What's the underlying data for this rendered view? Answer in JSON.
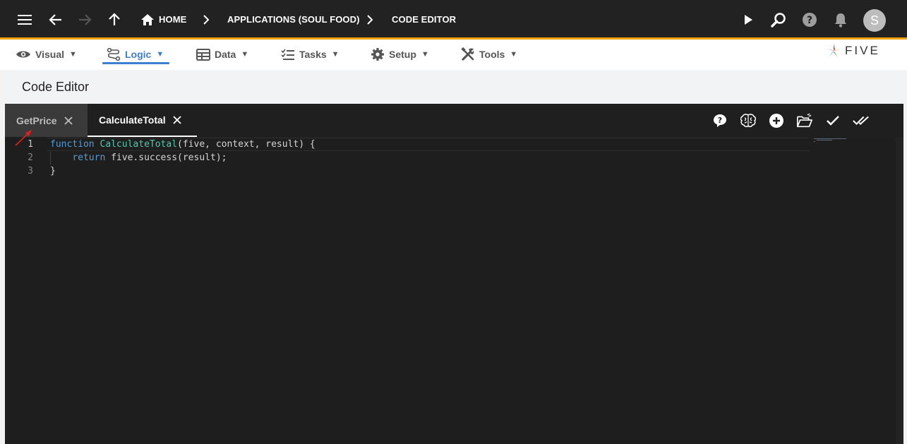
{
  "topbar": {
    "breadcrumbs": [
      "HOME",
      "APPLICATIONS (SOUL FOOD)",
      "CODE EDITOR"
    ],
    "avatar_initial": "S",
    "icons": [
      "menu-icon",
      "back-arrow-icon",
      "forward-arrow-icon",
      "up-arrow-icon",
      "home-icon",
      "play-icon",
      "search-icon",
      "help-icon",
      "bell-icon"
    ]
  },
  "menu": {
    "items": [
      {
        "label": "Visual",
        "icon": "eye-icon",
        "active": false
      },
      {
        "label": "Logic",
        "icon": "logic-icon",
        "active": true
      },
      {
        "label": "Data",
        "icon": "table-icon",
        "active": false
      },
      {
        "label": "Tasks",
        "icon": "tasks-icon",
        "active": false
      },
      {
        "label": "Setup",
        "icon": "gear-icon",
        "active": false
      },
      {
        "label": "Tools",
        "icon": "tools-icon",
        "active": false
      }
    ],
    "caret": "▼"
  },
  "logo": {
    "text": "FIVE"
  },
  "page": {
    "title": "Code Editor"
  },
  "tabs": [
    {
      "label": "GetPrice",
      "active": false
    },
    {
      "label": "CalculateTotal",
      "active": true
    }
  ],
  "toolbar_icons": [
    "help-bubble-icon",
    "brain-icon",
    "add-circle-icon",
    "open-folder-icon",
    "check-icon",
    "double-check-icon"
  ],
  "editor": {
    "line_numbers": [
      "1",
      "2",
      "3"
    ],
    "lines": [
      {
        "kw": "function",
        "fn": "CalculateTotal",
        "rest": "(five, context, result) {"
      },
      {
        "indent": "    ",
        "kw": "return",
        "rest": " five.success(result);"
      },
      {
        "rest": "}"
      }
    ]
  },
  "colors": {
    "topbar_bg": "#222222",
    "accent_orange": "#f0a30a",
    "active_blue": "#3f7fd0",
    "editor_bg": "#1e1e1e",
    "keyword": "#569cd6",
    "function_name": "#4ec9b0",
    "annotation_arrow": "#e02020"
  }
}
